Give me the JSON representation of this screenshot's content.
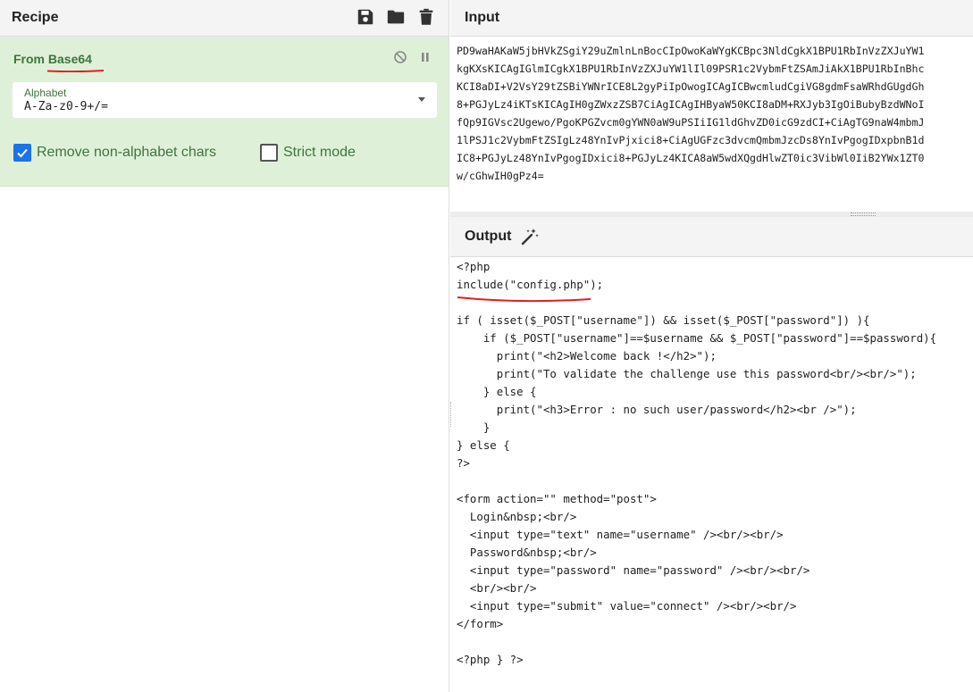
{
  "recipe": {
    "title": "Recipe",
    "icons": [
      "save-icon",
      "folder-icon",
      "trash-icon"
    ],
    "operation": {
      "prefix": "From ",
      "name": "Base64",
      "controls": [
        "disable-icon",
        "pause-icon"
      ],
      "alphabet_label": "Alphabet",
      "alphabet_value": "A-Za-z0-9+/=",
      "remove_non_alphabet_label": "Remove non-alphabet chars",
      "remove_non_alphabet_checked": true,
      "strict_mode_label": "Strict mode",
      "strict_mode_checked": false
    }
  },
  "input": {
    "title": "Input",
    "text": "PD9waHAKaW5jbHVkZSgiY29uZmlnLnBocCIpOwoKaWYgKCBpc3NldCgkX1BPU1RbInVzZXJuYW1\nkgKXsKICAgIGlmICgkX1BPU1RbInVzZXJuYW1lIl09PSR1c2VybmFtZSAmJiAkX1BPU1RbInBhc\nKCI8aDI+V2VsY29tZSBiYWNrICE8L2gyPiIpOwogICAgICBwcmludCgiVG8gdmFsaWRhdGUgdGh\n8+PGJyLz4iKTsKICAgIH0gZWxzZSB7CiAgICAgIHByaW50KCI8aDM+RXJyb3IgOiBubyBzdWNoI\nfQp9IGVsc2Ugewo/PgoKPGZvcm0gYWN0aW9uPSIiIG1ldGhvZD0icG9zdCI+CiAgTG9naW4mbmJ\n1lPSJ1c2VybmFtZSIgLz48YnIvPjxici8+CiAgUGFzc3dvcmQmbmJzcDs8YnIvPgogIDxpbnB1d\nIC8+PGJyLz48YnIvPgogIDxici8+PGJyLz4KICA8aW5wdXQgdHlwZT0ic3VibWl0IiB2YWx1ZT0\nw/cGhwIH0gPz4="
  },
  "output": {
    "title": "Output",
    "icon": "magic-wand-icon",
    "text": "<?php\ninclude(\"config.php\");\n\nif ( isset($_POST[\"username\"]) && isset($_POST[\"password\"]) ){\n    if ($_POST[\"username\"]==$username && $_POST[\"password\"]==$password){\n      print(\"<h2>Welcome back !</h2>\");\n      print(\"To validate the challenge use this password<br/><br/>\");\n    } else {\n      print(\"<h3>Error : no such user/password</h2><br />\");\n    }\n} else {\n?>\n\n<form action=\"\" method=\"post\">\n  Login&nbsp;<br/>\n  <input type=\"text\" name=\"username\" /><br/><br/>\n  Password&nbsp;<br/>\n  <input type=\"password\" name=\"password\" /><br/><br/>\n  <br/><br/>\n  <input type=\"submit\" value=\"connect\" /><br/><br/>\n</form>\n\n<?php } ?>"
  },
  "colors": {
    "accent_green": "#3c763d",
    "card_bg": "#dff0d8",
    "checkbox_blue": "#1a73e8",
    "annotation_red": "#e02020"
  }
}
